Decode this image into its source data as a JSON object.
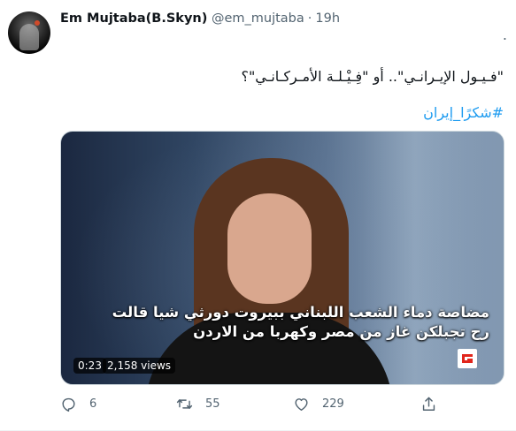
{
  "tweet": {
    "author_name": "Em Mujtaba(B.Skyn)",
    "handle": "@em_mujtaba",
    "separator": "·",
    "time": "19h",
    "leading_mark": ".",
    "text": "\"فـيـول الإيـرانـي\".. أو \"فِـيْـلـة الأمـركـانـي\"؟",
    "hashtag": "#شكرًا_إيران"
  },
  "media": {
    "caption_line1": "مضاصة دماء الشعب اللبناني ببيروت دورثي شيا قالت",
    "caption_line2": "رح تجبلكن غاز من مصر وكهربا من الاردن",
    "duration": "0:23",
    "views": "2,158 views"
  },
  "actions": {
    "reply_count": "6",
    "retweet_count": "55",
    "like_count": "229"
  },
  "icons": [
    "more-icon",
    "reply-icon",
    "retweet-icon",
    "like-icon",
    "share-icon",
    "channel-logo-icon"
  ],
  "colors": {
    "accent": "#1d9bf0",
    "secondary_text": "#536471",
    "primary_text": "#0f1419"
  }
}
